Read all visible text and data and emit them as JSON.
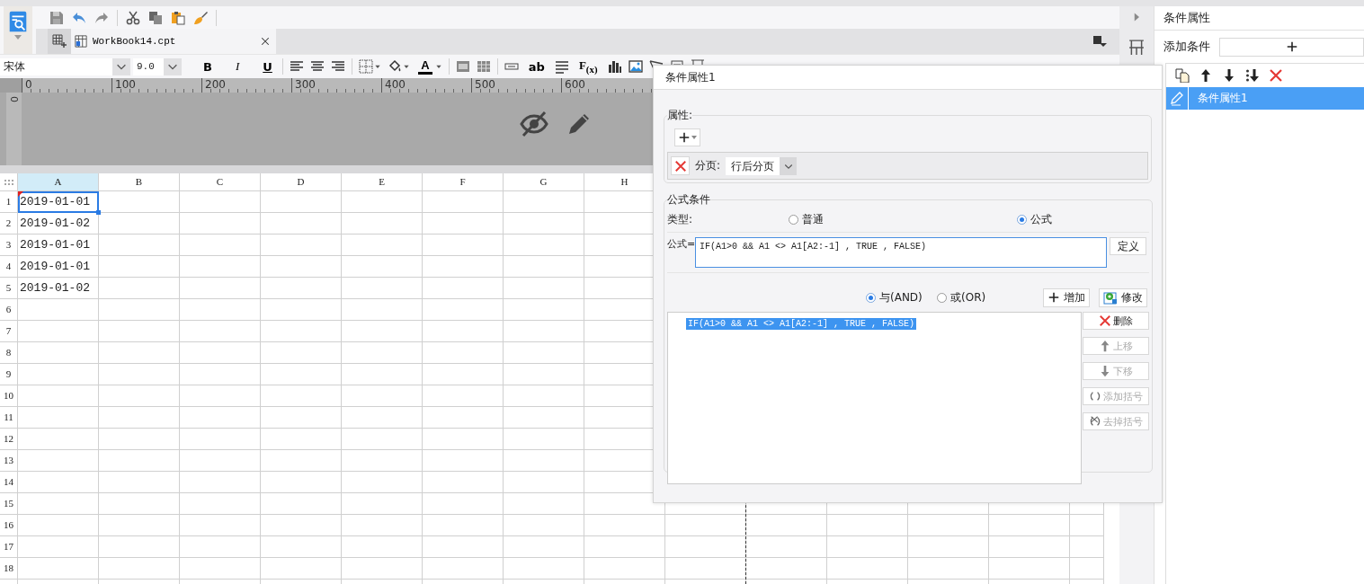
{
  "tab": {
    "label": "WorkBook14.cpt"
  },
  "format_bar": {
    "font": "宋体",
    "size": "9.0",
    "style_buttons": [
      "B",
      "I",
      "U"
    ],
    "font_color_button": "A",
    "text_buttons": [
      "ab",
      "F$_{(x)}$"
    ]
  },
  "ruler": {
    "ticks": [
      "0",
      "100",
      "200",
      "300",
      "400",
      "500",
      "600"
    ],
    "vertical_tick": "0"
  },
  "sheet": {
    "columns": [
      {
        "label": "A",
        "selected": true
      },
      {
        "label": "B",
        "selected": false
      },
      {
        "label": "C",
        "selected": false
      },
      {
        "label": "D",
        "selected": false
      },
      {
        "label": "E",
        "selected": false
      },
      {
        "label": "F",
        "selected": false
      },
      {
        "label": "G",
        "selected": false
      },
      {
        "label": "H",
        "selected": false
      }
    ],
    "rows": [
      {
        "label": "1",
        "cells": [
          {
            "text": "2019-01-01",
            "selected": true,
            "flagged": true
          }
        ]
      },
      {
        "label": "2",
        "cells": [
          {
            "text": "2019-01-02",
            "selected": false,
            "flagged": false
          }
        ]
      },
      {
        "label": "3",
        "cells": [
          {
            "text": "2019-01-01",
            "selected": false,
            "flagged": false
          }
        ]
      },
      {
        "label": "4",
        "cells": [
          {
            "text": "2019-01-01",
            "selected": false,
            "flagged": false
          }
        ]
      },
      {
        "label": "5",
        "cells": [
          {
            "text": "2019-01-02",
            "selected": false,
            "flagged": false
          }
        ]
      },
      {
        "label": "6",
        "cells": []
      },
      {
        "label": "7",
        "cells": []
      },
      {
        "label": "8",
        "cells": []
      },
      {
        "label": "9",
        "cells": []
      },
      {
        "label": "10",
        "cells": []
      },
      {
        "label": "11",
        "cells": []
      },
      {
        "label": "12",
        "cells": []
      },
      {
        "label": "13",
        "cells": []
      },
      {
        "label": "14",
        "cells": []
      },
      {
        "label": "15",
        "cells": []
      },
      {
        "label": "16",
        "cells": []
      },
      {
        "label": "17",
        "cells": []
      },
      {
        "label": "18",
        "cells": []
      }
    ]
  },
  "dialog": {
    "title": "条件属性1",
    "attributes": {
      "legend": "属性:",
      "items": [
        {
          "label": "分页:",
          "value": "行后分页"
        }
      ]
    },
    "formula": {
      "legend": "公式条件",
      "type_label": "类型:",
      "types": [
        {
          "label": "普通",
          "selected": false
        },
        {
          "label": "公式",
          "selected": true
        }
      ],
      "formula_label": "公式=",
      "formula_value": "IF(A1>0 && A1 <> A1[A2:-1] , TRUE , FALSE)",
      "define_button": "定义",
      "logic": [
        {
          "label": "与(AND)",
          "selected": true
        },
        {
          "label": "或(OR)",
          "selected": false
        }
      ],
      "action_buttons": [
        {
          "kind": "add",
          "label": "增加"
        },
        {
          "kind": "edit",
          "label": "修改"
        }
      ],
      "conditions": [
        {
          "text": "IF(A1>0 && A1 <> A1[A2:-1] , TRUE , FALSE)",
          "selected": true
        }
      ],
      "side_buttons": [
        {
          "kind": "delete",
          "label": "删除",
          "disabled": false
        },
        {
          "kind": "up",
          "label": "上移",
          "disabled": true
        },
        {
          "kind": "down",
          "label": "下移",
          "disabled": true
        },
        {
          "kind": "add_paren",
          "label": "添加括号",
          "disabled": true
        },
        {
          "kind": "remove_paren",
          "label": "去掉括号",
          "disabled": true
        }
      ]
    }
  },
  "panel": {
    "title": "条件属性",
    "add_label": "添加条件",
    "items": [
      {
        "label": "条件属性1",
        "selected": true
      }
    ]
  }
}
